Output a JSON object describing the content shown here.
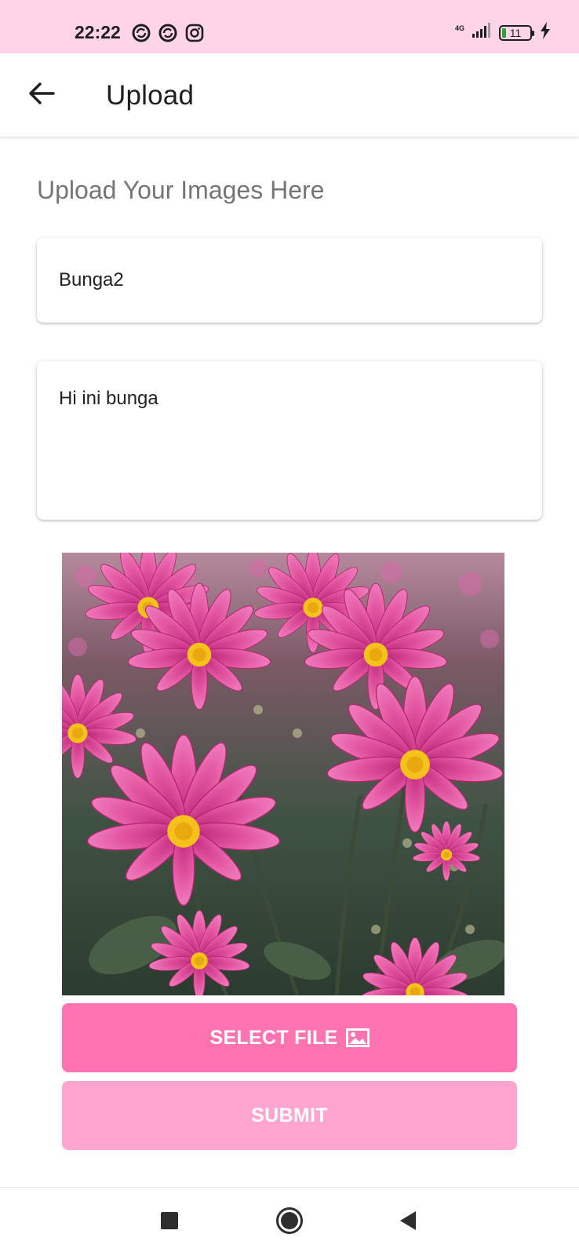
{
  "status_bar": {
    "time": "22:22",
    "left_icons": [
      "sync-icon",
      "sync-icon",
      "instagram-icon"
    ],
    "network_type": "4G",
    "battery_level": "11",
    "right_icons": [
      "signal-icon",
      "battery-icon",
      "charging-icon"
    ]
  },
  "app_bar": {
    "back_icon": "arrow-left-icon",
    "title": "Upload"
  },
  "form": {
    "heading": "Upload Your Images Here",
    "title_value": "Bunga2",
    "description_value": "Hi ini bunga"
  },
  "preview": {
    "subject": "pink-flowers-photo"
  },
  "buttons": {
    "select_file_label": "SELECT FILE",
    "select_file_icon": "image-icon",
    "submit_label": "SUBMIT"
  },
  "nav_bar": {
    "icons": [
      "recents-square-icon",
      "home-circle-icon",
      "back-triangle-icon"
    ]
  },
  "colors": {
    "status_bar_bg": "#fed4e8",
    "accent": "#ff74b0",
    "accent_disabled": "#ffa5cf",
    "heading_text": "#757575"
  }
}
